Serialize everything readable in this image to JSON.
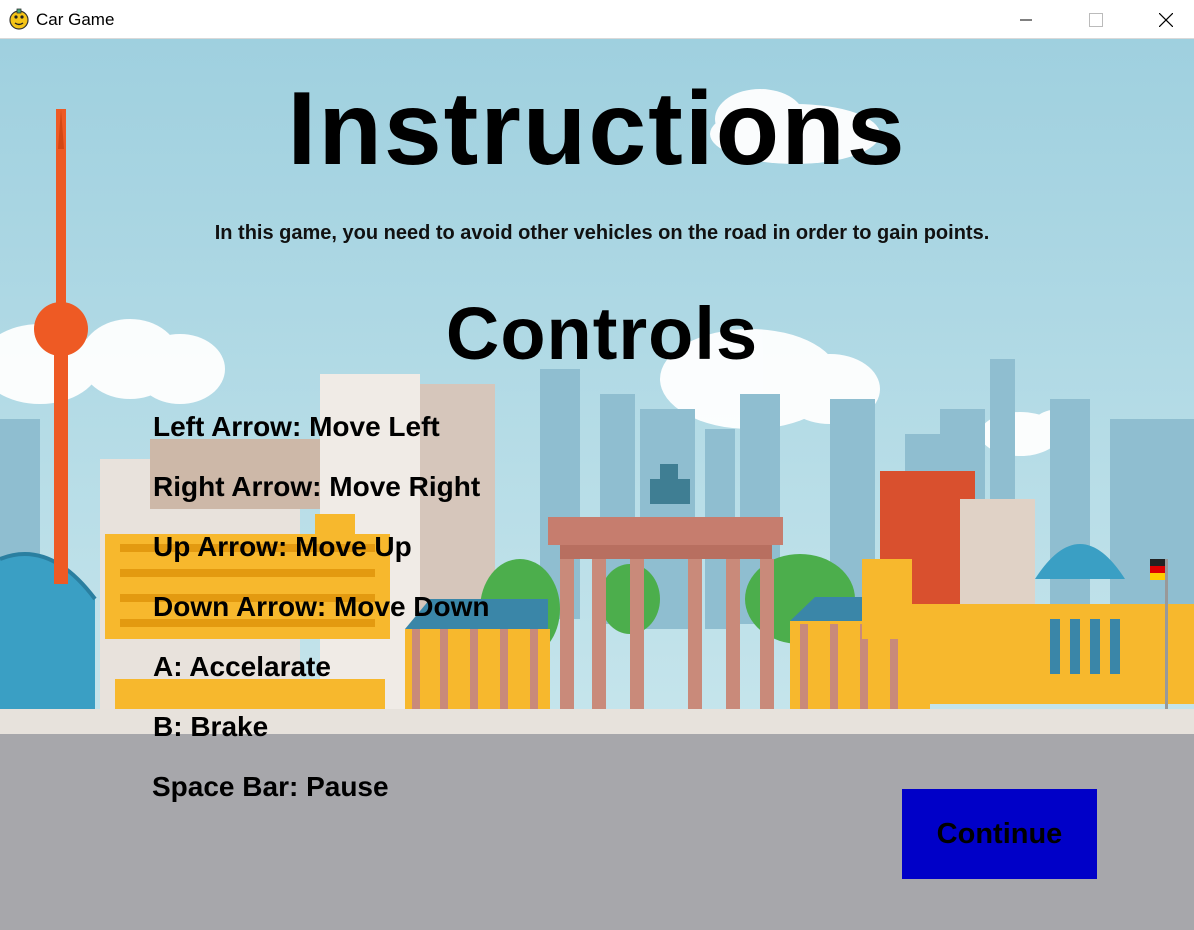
{
  "window": {
    "title": "Car Game",
    "app_icon": "pygame-snake-icon",
    "controls": [
      "minimize-icon",
      "maximize-icon",
      "close-icon"
    ]
  },
  "screen": {
    "heading": "Instructions",
    "intro": "In this game, you need to avoid other vehicles on the road in order to gain points.",
    "controls_heading": "Controls",
    "controls": [
      "Left Arrow: Move Left",
      "Right Arrow: Move Right",
      "Up Arrow: Move Up",
      "Down Arrow: Move Down",
      "A: Accelarate",
      "B: Brake",
      "Space Bar: Pause"
    ],
    "continue_label": "Continue"
  },
  "colors": {
    "sky": "#a9d4e2",
    "road": "#a7a7ab",
    "continue_button": "#0000c8",
    "tower": "#ee5a24"
  }
}
